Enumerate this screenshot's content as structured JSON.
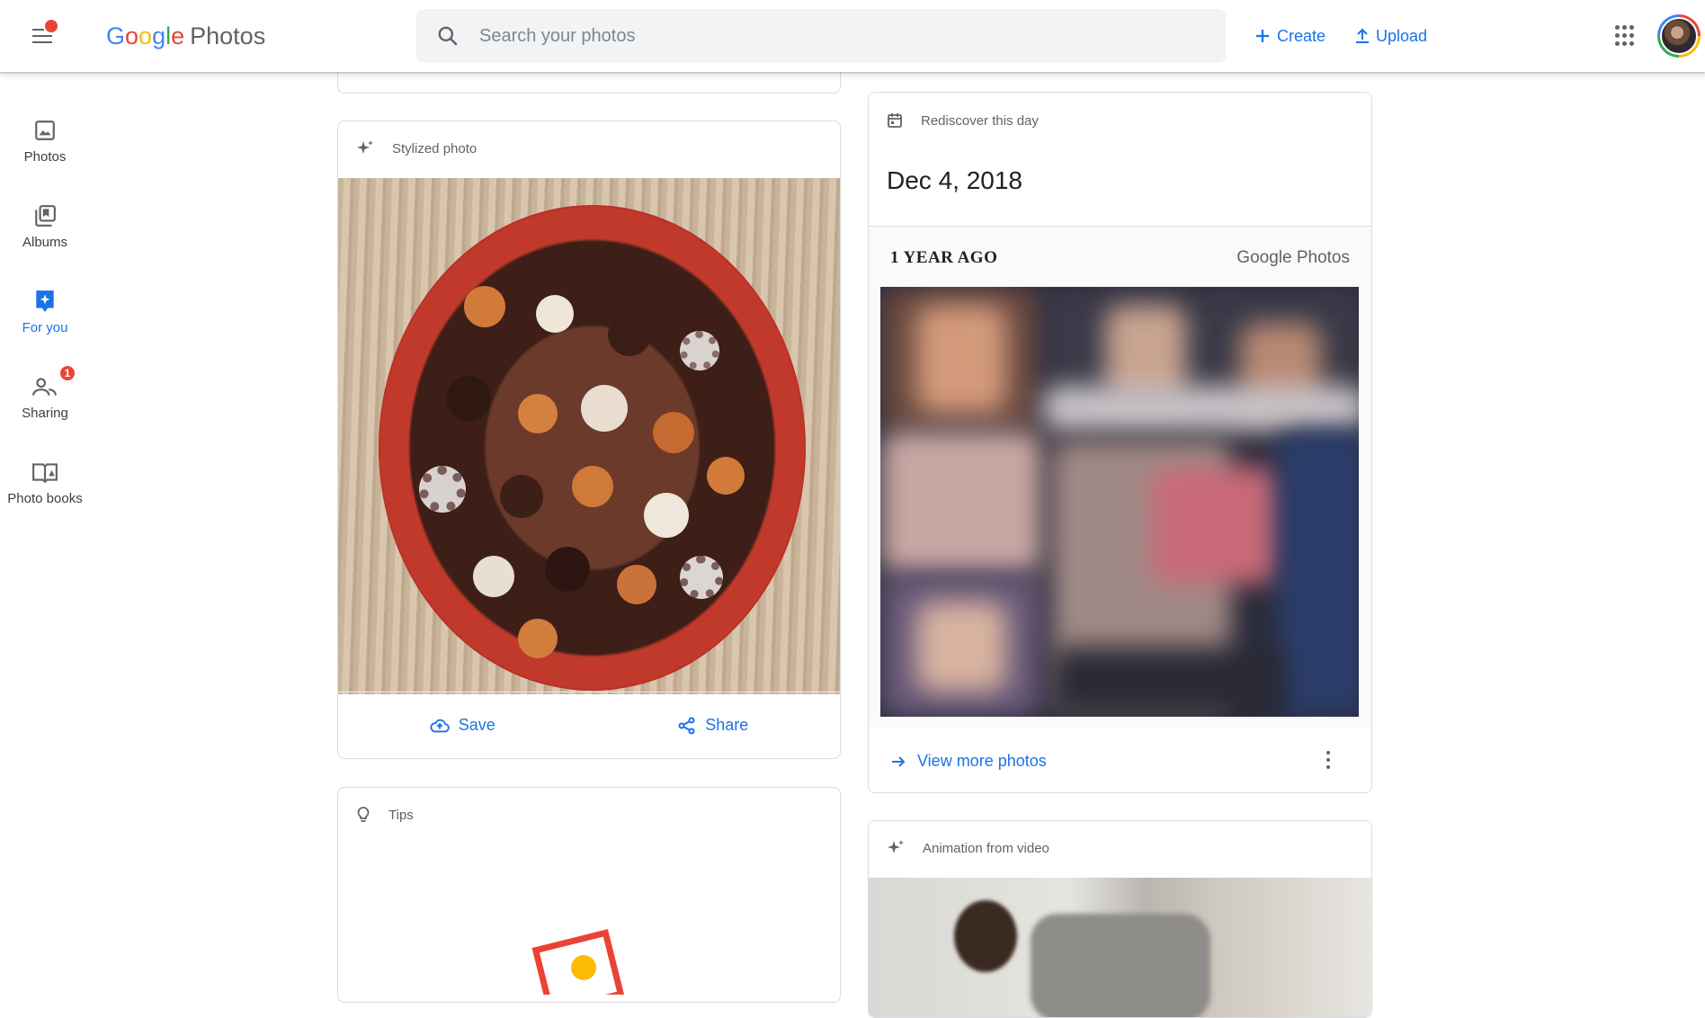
{
  "app": {
    "title_parts": [
      "G",
      "o",
      "o",
      "g",
      "l",
      "e"
    ],
    "title_colors": [
      "#4285f4",
      "#ea4335",
      "#fbbc05",
      "#4285f4",
      "#34a853",
      "#ea4335"
    ],
    "product": "Photos"
  },
  "search": {
    "placeholder": "Search your photos",
    "value": ""
  },
  "header": {
    "create_label": "Create",
    "upload_label": "Upload"
  },
  "sidebar": {
    "items": [
      {
        "label": "Photos",
        "icon": "photo-icon",
        "active": false
      },
      {
        "label": "Albums",
        "icon": "albums-icon",
        "active": false
      },
      {
        "label": "For you",
        "icon": "for-you-icon",
        "active": true
      },
      {
        "label": "Sharing",
        "icon": "sharing-icon",
        "active": false,
        "badge": "1"
      },
      {
        "label": "Photo books",
        "icon": "photo-books-icon",
        "active": false
      }
    ]
  },
  "cards": {
    "stylized": {
      "title": "Stylized photo",
      "save_label": "Save",
      "share_label": "Share"
    },
    "tips": {
      "title": "Tips"
    },
    "rediscover": {
      "title": "Rediscover this day",
      "date": "Dec 4, 2018",
      "collage_heading": "1 YEAR AGO",
      "collage_brand": "Google Photos",
      "view_more_label": "View more photos"
    },
    "animation": {
      "title": "Animation from video"
    }
  },
  "colors": {
    "accent": "#1a73e8",
    "badge": "#ea4335",
    "border": "#dadce0"
  }
}
